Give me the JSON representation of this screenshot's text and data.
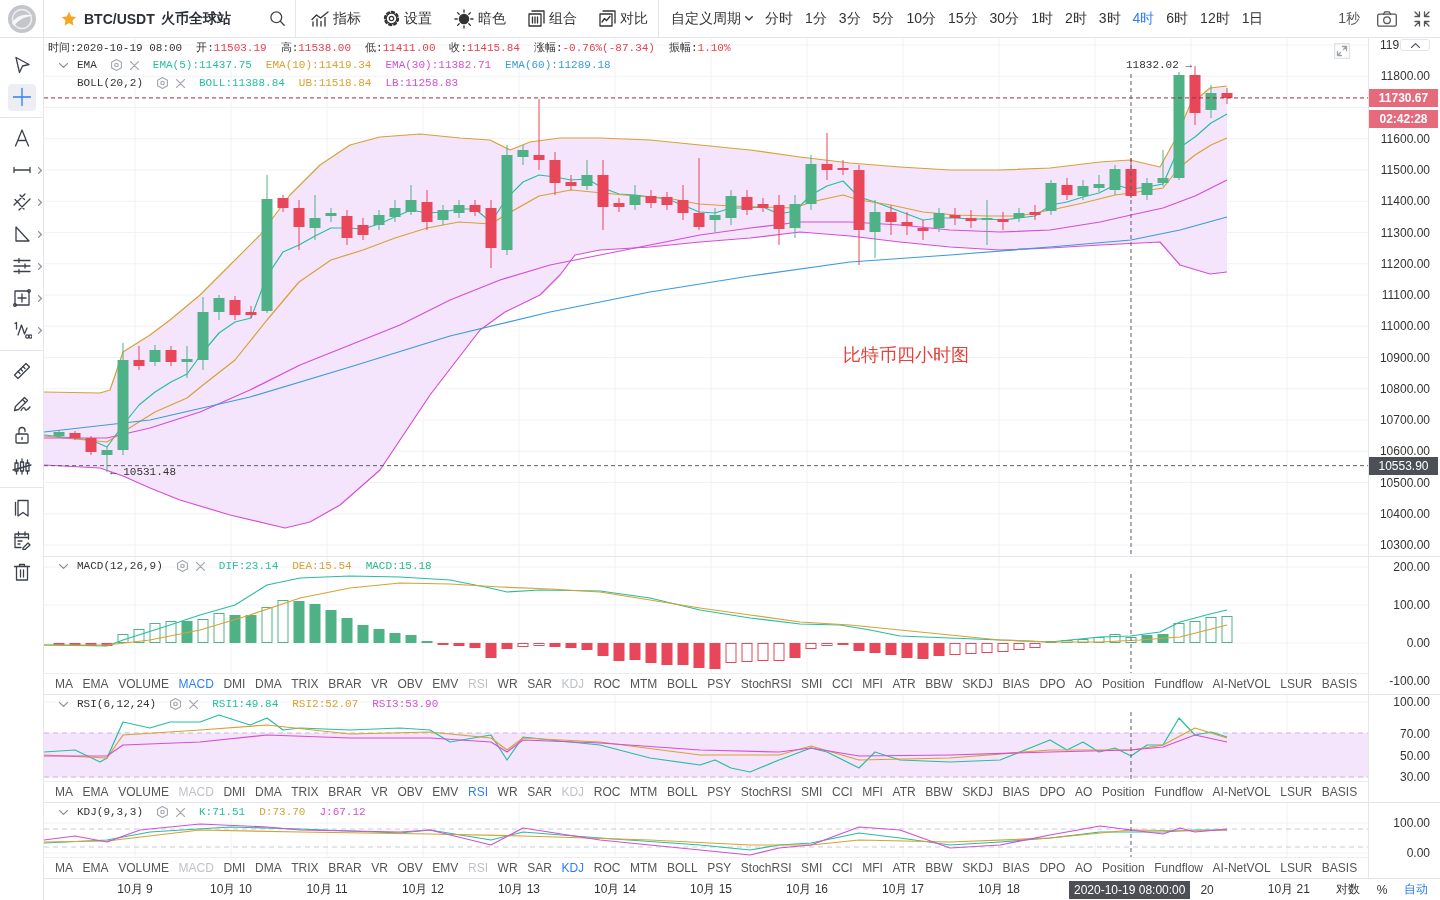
{
  "header": {
    "symbol": {
      "favorite": true,
      "pair": "BTC/USDT",
      "exchange": "火币全球站"
    },
    "tools": [
      {
        "label": "指标"
      },
      {
        "label": "设置"
      },
      {
        "label": "暗色"
      },
      {
        "label": "组合"
      },
      {
        "label": "对比"
      }
    ],
    "custom_period": "自定义周期",
    "periods": [
      {
        "label": "分时",
        "selected": false
      },
      {
        "label": "1分",
        "selected": false
      },
      {
        "label": "3分",
        "selected": false
      },
      {
        "label": "5分",
        "selected": false
      },
      {
        "label": "10分",
        "selected": false
      },
      {
        "label": "15分",
        "selected": false
      },
      {
        "label": "30分",
        "selected": false
      },
      {
        "label": "1时",
        "selected": false
      },
      {
        "label": "2时",
        "selected": false
      },
      {
        "label": "3时",
        "selected": false
      },
      {
        "label": "4时",
        "selected": true
      },
      {
        "label": "6时",
        "selected": false
      },
      {
        "label": "12时",
        "selected": false
      },
      {
        "label": "1日",
        "selected": false
      }
    ],
    "refresh_interval": "1秒"
  },
  "drawing_tools": [
    [
      {
        "selected": false,
        "submenu": false
      },
      {
        "selected": true,
        "submenu": false
      }
    ],
    [
      {
        "selected": false,
        "submenu": false
      },
      {
        "selected": false,
        "submenu": true
      },
      {
        "selected": false,
        "submenu": true
      },
      {
        "selected": false,
        "submenu": true
      },
      {
        "selected": false,
        "submenu": true
      },
      {
        "selected": false,
        "submenu": true
      },
      {
        "selected": false,
        "submenu": true
      }
    ],
    [
      {
        "selected": false,
        "submenu": false
      },
      {
        "selected": false,
        "submenu": false
      },
      {
        "selected": false,
        "submenu": false
      },
      {
        "selected": false,
        "submenu": false
      }
    ],
    [
      {
        "selected": false,
        "submenu": false
      },
      {
        "selected": false,
        "submenu": false
      },
      {
        "selected": false,
        "submenu": false
      }
    ]
  ],
  "main_pane": {
    "quote": {
      "time_label": "时间:",
      "time": "2020-10-19 08:00",
      "fields": [
        {
          "label": "开:",
          "value": "11503.19",
          "falling": true
        },
        {
          "label": "高:",
          "value": "11538.00",
          "falling": true
        },
        {
          "label": "低:",
          "value": "11411.00",
          "falling": true
        },
        {
          "label": "收:",
          "value": "11415.84",
          "falling": true
        },
        {
          "label": "涨幅:",
          "value": "-0.76%(-87.34)",
          "falling": true
        },
        {
          "label": "振幅:",
          "value": "1.10%",
          "falling": true
        }
      ]
    },
    "overlays": [
      {
        "title": "EMA",
        "toggle": true,
        "values": [
          {
            "text": "EMA(5):11437.75",
            "color": "#25bfa0"
          },
          {
            "text": "EMA(10):11419.34",
            "color": "#d8a133"
          },
          {
            "text": "EMA(30):11382.71",
            "color": "#d44fd6"
          },
          {
            "text": "EMA(60):11289.18",
            "color": "#3b9bdc"
          }
        ]
      },
      {
        "title": "BOLL(20,2)",
        "toggle": false,
        "values": [
          {
            "text": "BOLL:11388.84",
            "color": "#25bfa0"
          },
          {
            "text": "UB:11518.84",
            "color": "#d8a133"
          },
          {
            "text": "LB:11258.83",
            "color": "#d44fd6"
          }
        ]
      }
    ],
    "high_marker": "11832.02 →",
    "low_marker": "← 10531.48",
    "annotation": "比特币四小时图",
    "axis": {
      "top_label": "119",
      "labels": [
        "11800.00",
        "11600.00",
        "11500.00",
        "11400.00",
        "11300.00",
        "11200.00",
        "11100.00",
        "11000.00",
        "10900.00",
        "10800.00",
        "10700.00",
        "10600.00",
        "10500.00",
        "10400.00",
        "10300.00"
      ]
    },
    "last_price": "11730.67",
    "countdown": "02:42:28",
    "crosshair_price": "10553.90"
  },
  "sub_panes": [
    {
      "title": "MACD(12,26,9)",
      "toggle": true,
      "values": [
        {
          "text": "DIF:23.14",
          "color": "#25bfa0"
        },
        {
          "text": "DEA:15.54",
          "color": "#d8a133"
        },
        {
          "text": "MACD:15.18",
          "color": "#26b98a"
        }
      ],
      "axis": [
        "200.00",
        "100.00",
        "0.00",
        "-100.00"
      ],
      "tabs": [
        {
          "label": "MA",
          "selected": false,
          "disabled": false
        },
        {
          "label": "EMA",
          "selected": false,
          "disabled": false
        },
        {
          "label": "VOLUME",
          "selected": false,
          "disabled": false
        },
        {
          "label": "MACD",
          "selected": true,
          "disabled": false
        },
        {
          "label": "DMI",
          "selected": false,
          "disabled": false
        },
        {
          "label": "DMA",
          "selected": false,
          "disabled": false
        },
        {
          "label": "TRIX",
          "selected": false,
          "disabled": false
        },
        {
          "label": "BRAR",
          "selected": false,
          "disabled": false
        },
        {
          "label": "VR",
          "selected": false,
          "disabled": false
        },
        {
          "label": "OBV",
          "selected": false,
          "disabled": false
        },
        {
          "label": "EMV",
          "selected": false,
          "disabled": false
        },
        {
          "label": "RSI",
          "selected": false,
          "disabled": true
        },
        {
          "label": "WR",
          "selected": false,
          "disabled": false
        },
        {
          "label": "SAR",
          "selected": false,
          "disabled": false
        },
        {
          "label": "KDJ",
          "selected": false,
          "disabled": true
        },
        {
          "label": "ROC",
          "selected": false,
          "disabled": false
        },
        {
          "label": "MTM",
          "selected": false,
          "disabled": false
        },
        {
          "label": "BOLL",
          "selected": false,
          "disabled": false
        },
        {
          "label": "PSY",
          "selected": false,
          "disabled": false
        },
        {
          "label": "StochRSI",
          "selected": false,
          "disabled": false
        },
        {
          "label": "SMI",
          "selected": false,
          "disabled": false
        },
        {
          "label": "CCI",
          "selected": false,
          "disabled": false
        },
        {
          "label": "MFI",
          "selected": false,
          "disabled": false
        },
        {
          "label": "ATR",
          "selected": false,
          "disabled": false
        },
        {
          "label": "BBW",
          "selected": false,
          "disabled": false
        },
        {
          "label": "SKDJ",
          "selected": false,
          "disabled": false
        },
        {
          "label": "BIAS",
          "selected": false,
          "disabled": false
        },
        {
          "label": "DPO",
          "selected": false,
          "disabled": false
        },
        {
          "label": "AO",
          "selected": false,
          "disabled": false
        },
        {
          "label": "Position",
          "selected": false,
          "disabled": false
        },
        {
          "label": "Fundflow",
          "selected": false,
          "disabled": false
        },
        {
          "label": "AI-NetVOL",
          "selected": false,
          "disabled": false
        },
        {
          "label": "LSUR",
          "selected": false,
          "disabled": false
        },
        {
          "label": "BASIS",
          "selected": false,
          "disabled": false
        }
      ]
    },
    {
      "title": "RSI(6,12,24)",
      "toggle": true,
      "values": [
        {
          "text": "RSI1:49.84",
          "color": "#25bfa0"
        },
        {
          "text": "RSI2:52.07",
          "color": "#d8a133"
        },
        {
          "text": "RSI3:53.90",
          "color": "#d44fd6"
        }
      ],
      "axis": [
        "100.00",
        "70.00",
        "50.00",
        "30.00"
      ],
      "tabs": [
        {
          "label": "MA",
          "selected": false,
          "disabled": false
        },
        {
          "label": "EMA",
          "selected": false,
          "disabled": false
        },
        {
          "label": "VOLUME",
          "selected": false,
          "disabled": false
        },
        {
          "label": "MACD",
          "selected": false,
          "disabled": true
        },
        {
          "label": "DMI",
          "selected": false,
          "disabled": false
        },
        {
          "label": "DMA",
          "selected": false,
          "disabled": false
        },
        {
          "label": "TRIX",
          "selected": false,
          "disabled": false
        },
        {
          "label": "BRAR",
          "selected": false,
          "disabled": false
        },
        {
          "label": "VR",
          "selected": false,
          "disabled": false
        },
        {
          "label": "OBV",
          "selected": false,
          "disabled": false
        },
        {
          "label": "EMV",
          "selected": false,
          "disabled": false
        },
        {
          "label": "RSI",
          "selected": true,
          "disabled": false
        },
        {
          "label": "WR",
          "selected": false,
          "disabled": false
        },
        {
          "label": "SAR",
          "selected": false,
          "disabled": false
        },
        {
          "label": "KDJ",
          "selected": false,
          "disabled": true
        },
        {
          "label": "ROC",
          "selected": false,
          "disabled": false
        },
        {
          "label": "MTM",
          "selected": false,
          "disabled": false
        },
        {
          "label": "BOLL",
          "selected": false,
          "disabled": false
        },
        {
          "label": "PSY",
          "selected": false,
          "disabled": false
        },
        {
          "label": "StochRSI",
          "selected": false,
          "disabled": false
        },
        {
          "label": "SMI",
          "selected": false,
          "disabled": false
        },
        {
          "label": "CCI",
          "selected": false,
          "disabled": false
        },
        {
          "label": "MFI",
          "selected": false,
          "disabled": false
        },
        {
          "label": "ATR",
          "selected": false,
          "disabled": false
        },
        {
          "label": "BBW",
          "selected": false,
          "disabled": false
        },
        {
          "label": "SKDJ",
          "selected": false,
          "disabled": false
        },
        {
          "label": "BIAS",
          "selected": false,
          "disabled": false
        },
        {
          "label": "DPO",
          "selected": false,
          "disabled": false
        },
        {
          "label": "AO",
          "selected": false,
          "disabled": false
        },
        {
          "label": "Position",
          "selected": false,
          "disabled": false
        },
        {
          "label": "Fundflow",
          "selected": false,
          "disabled": false
        },
        {
          "label": "AI-NetVOL",
          "selected": false,
          "disabled": false
        },
        {
          "label": "LSUR",
          "selected": false,
          "disabled": false
        },
        {
          "label": "BASIS",
          "selected": false,
          "disabled": false
        }
      ]
    },
    {
      "title": "KDJ(9,3,3)",
      "toggle": true,
      "values": [
        {
          "text": "K:71.51",
          "color": "#25bfa0"
        },
        {
          "text": "D:73.70",
          "color": "#d8a133"
        },
        {
          "text": "J:67.12",
          "color": "#d44fd6"
        }
      ],
      "axis": [
        "100.00",
        "0.00"
      ],
      "tabs": [
        {
          "label": "MA",
          "selected": false,
          "disabled": false
        },
        {
          "label": "EMA",
          "selected": false,
          "disabled": false
        },
        {
          "label": "VOLUME",
          "selected": false,
          "disabled": false
        },
        {
          "label": "MACD",
          "selected": false,
          "disabled": true
        },
        {
          "label": "DMI",
          "selected": false,
          "disabled": false
        },
        {
          "label": "DMA",
          "selected": false,
          "disabled": false
        },
        {
          "label": "TRIX",
          "selected": false,
          "disabled": false
        },
        {
          "label": "BRAR",
          "selected": false,
          "disabled": false
        },
        {
          "label": "VR",
          "selected": false,
          "disabled": false
        },
        {
          "label": "OBV",
          "selected": false,
          "disabled": false
        },
        {
          "label": "EMV",
          "selected": false,
          "disabled": false
        },
        {
          "label": "RSI",
          "selected": false,
          "disabled": true
        },
        {
          "label": "WR",
          "selected": false,
          "disabled": false
        },
        {
          "label": "SAR",
          "selected": false,
          "disabled": false
        },
        {
          "label": "KDJ",
          "selected": true,
          "disabled": false
        },
        {
          "label": "ROC",
          "selected": false,
          "disabled": false
        },
        {
          "label": "MTM",
          "selected": false,
          "disabled": false
        },
        {
          "label": "BOLL",
          "selected": false,
          "disabled": false
        },
        {
          "label": "PSY",
          "selected": false,
          "disabled": false
        },
        {
          "label": "StochRSI",
          "selected": false,
          "disabled": false
        },
        {
          "label": "SMI",
          "selected": false,
          "disabled": false
        },
        {
          "label": "CCI",
          "selected": false,
          "disabled": false
        },
        {
          "label": "MFI",
          "selected": false,
          "disabled": false
        },
        {
          "label": "ATR",
          "selected": false,
          "disabled": false
        },
        {
          "label": "BBW",
          "selected": false,
          "disabled": false
        },
        {
          "label": "SKDJ",
          "selected": false,
          "disabled": false
        },
        {
          "label": "BIAS",
          "selected": false,
          "disabled": false
        },
        {
          "label": "DPO",
          "selected": false,
          "disabled": false
        },
        {
          "label": "AO",
          "selected": false,
          "disabled": false
        },
        {
          "label": "Position",
          "selected": false,
          "disabled": false
        },
        {
          "label": "Fundflow",
          "selected": false,
          "disabled": false
        },
        {
          "label": "AI-NetVOL",
          "selected": false,
          "disabled": false
        },
        {
          "label": "LSUR",
          "selected": false,
          "disabled": false
        },
        {
          "label": "BASIS",
          "selected": false,
          "disabled": false
        }
      ]
    }
  ],
  "time_axis": {
    "labels": [
      "10月 9",
      "10月 10",
      "10月 11",
      "10月 12",
      "10月 13",
      "10月 14",
      "10月 15",
      "10月 16",
      "10月 17",
      "10月 18"
    ],
    "crosshair_time": "2020-10-19 08:00:00",
    "after_crosshair": [
      "20",
      "10月 21"
    ],
    "options": [
      {
        "label": "对数",
        "selected": false
      },
      {
        "label": "%",
        "selected": false
      },
      {
        "label": "自动",
        "selected": true
      }
    ]
  }
}
